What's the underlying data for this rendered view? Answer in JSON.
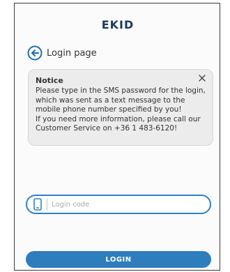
{
  "brand": "EKID",
  "back_link": {
    "label": "Login page",
    "icon": "arrow-left-circle-icon"
  },
  "notice": {
    "title": "Notice",
    "text": "Please type in the SMS password for the login, which was sent as a text message to the mobile phone number specified by you!\nIf you need more information, please call our Customer Service on +36 1 483-6120!",
    "close_icon": "close-icon"
  },
  "login_code": {
    "placeholder": "Login code",
    "value": "",
    "icon": "mobile-phone-icon"
  },
  "login_button": {
    "label": "LOGIN"
  },
  "colors": {
    "accent": "#2e7dbd",
    "brand": "#1d3a5c",
    "notice_bg": "#ececec"
  }
}
